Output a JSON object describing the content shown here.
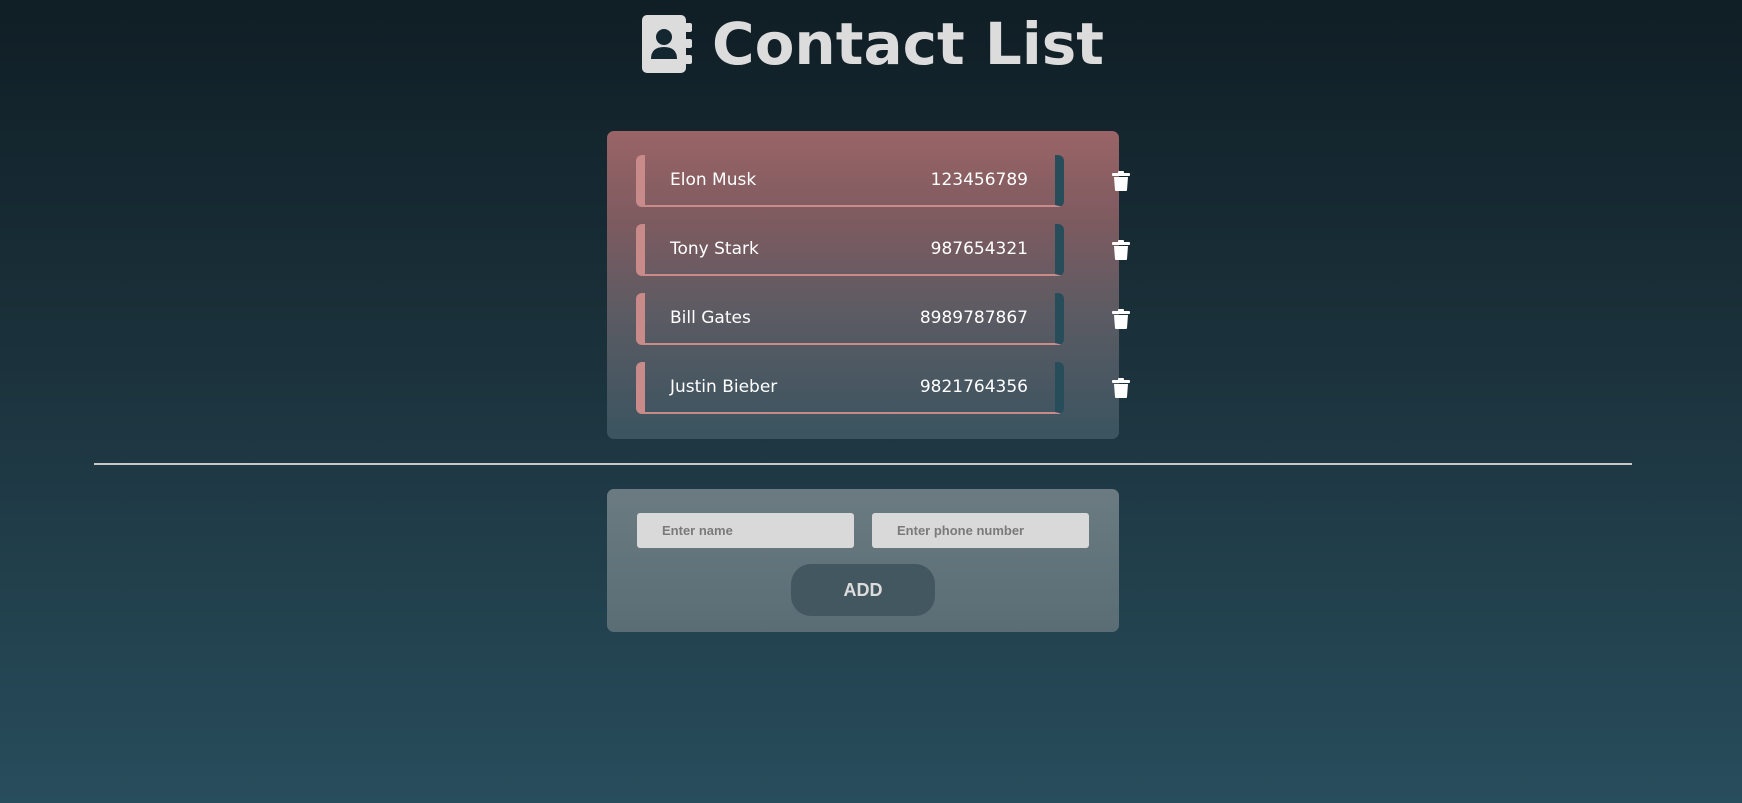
{
  "app": {
    "title": "Contact List",
    "title_icon": "address-book-icon"
  },
  "contacts": [
    {
      "name": "Elon Musk",
      "phone": "123456789",
      "delete_icon": "trash-icon"
    },
    {
      "name": "Tony Stark",
      "phone": "987654321",
      "delete_icon": "trash-icon"
    },
    {
      "name": "Bill Gates",
      "phone": "8989787867",
      "delete_icon": "trash-icon"
    },
    {
      "name": "Justin Bieber",
      "phone": "9821764356",
      "delete_icon": "trash-icon"
    }
  ],
  "form": {
    "name_placeholder": "Enter name",
    "phone_placeholder": "Enter phone number",
    "name_value": "",
    "phone_value": "",
    "add_label": "ADD"
  },
  "colors": {
    "accent_left": "#c98b8a",
    "accent_right": "#274c5a",
    "title_text": "#dcdcdc"
  }
}
